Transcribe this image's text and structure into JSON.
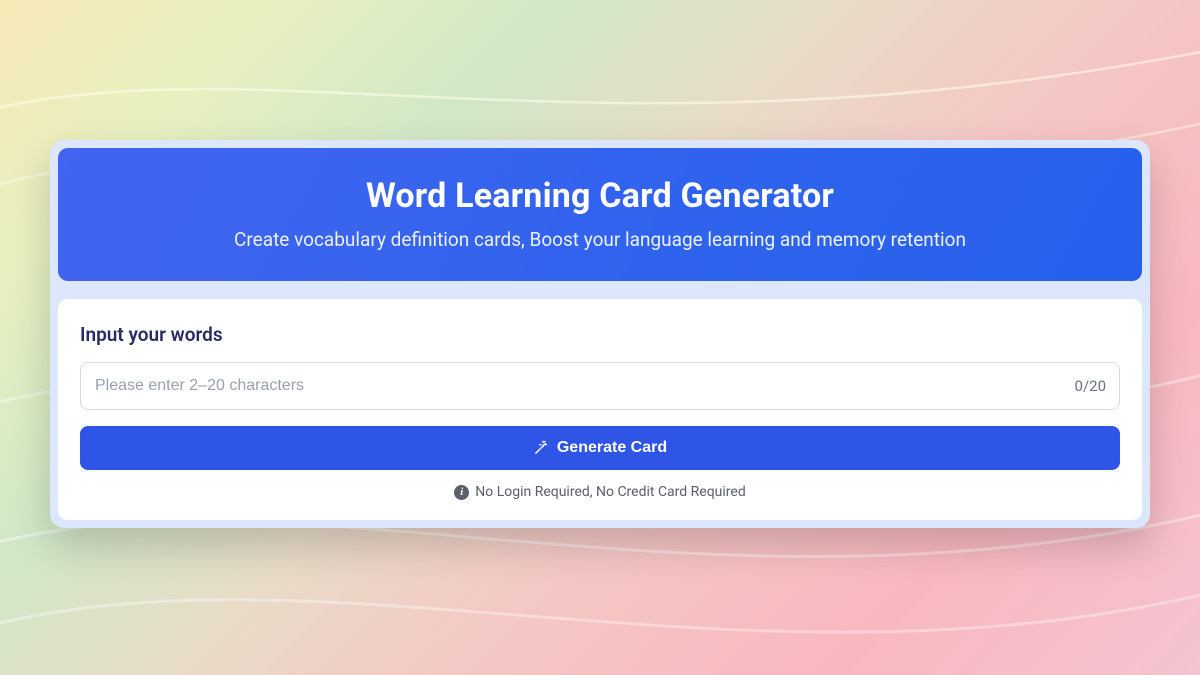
{
  "header": {
    "title": "Word Learning Card Generator",
    "subtitle": "Create vocabulary definition cards, Boost your language learning and memory retention"
  },
  "input": {
    "label": "Input your words",
    "placeholder": "Please enter 2–20 characters",
    "value": "",
    "char_count": "0/20"
  },
  "actions": {
    "generate_label": "Generate Card"
  },
  "footer": {
    "note": "No Login Required, No Credit Card Required"
  }
}
